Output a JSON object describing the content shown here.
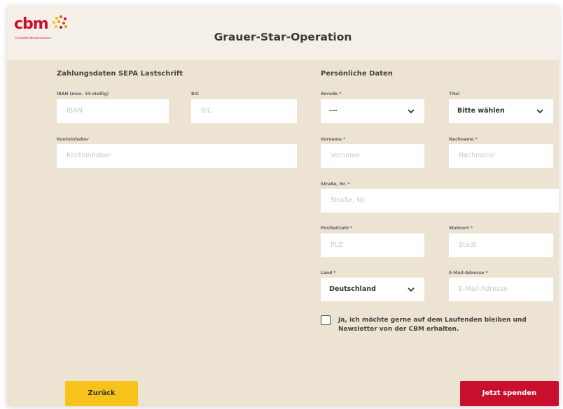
{
  "header": {
    "logo_text": "cbm",
    "logo_subtitle": "Christoffel-Blindenmission",
    "title": "Grauer-Star-Operation"
  },
  "payment": {
    "heading": "Zahlungsdaten SEPA Lastschrift",
    "iban_label": "IBAN (max. 34-stellig)",
    "iban_placeholder": "IBAN",
    "bic_label": "BIC",
    "bic_placeholder": "BIC",
    "holder_label": "Kontoinhaber",
    "holder_placeholder": "Kontoinhaber"
  },
  "personal": {
    "heading": "Persönliche Daten",
    "salutation_label": "Anrede *",
    "salutation_value": "---",
    "title_label": "Titel",
    "title_value": "Bitte wählen",
    "firstname_label": "Vorname *",
    "firstname_placeholder": "Vorname",
    "lastname_label": "Nachname *",
    "lastname_placeholder": "Nachname",
    "street_label": "Straße, Nr. *",
    "street_placeholder": "Straße, Nr.",
    "zip_label": "Postleitzahl *",
    "zip_placeholder": "PLZ",
    "city_label": "Wohnort *",
    "city_placeholder": "Stadt",
    "country_label": "Land *",
    "country_value": "Deutschland",
    "email_label": "E-Mail-Adresse *",
    "email_placeholder": "E-Mail-Adresse"
  },
  "newsletter": {
    "text": "Ja, ich möchte gerne auf dem Laufenden bleiben und Newsletter von der CBM erhalten."
  },
  "buttons": {
    "back": "Zurück",
    "donate": "Jetzt spenden"
  },
  "colors": {
    "background": "#ece3d3",
    "header": "#f5f0e7",
    "primary_red": "#c8102e",
    "yellow": "#f7c31a"
  }
}
